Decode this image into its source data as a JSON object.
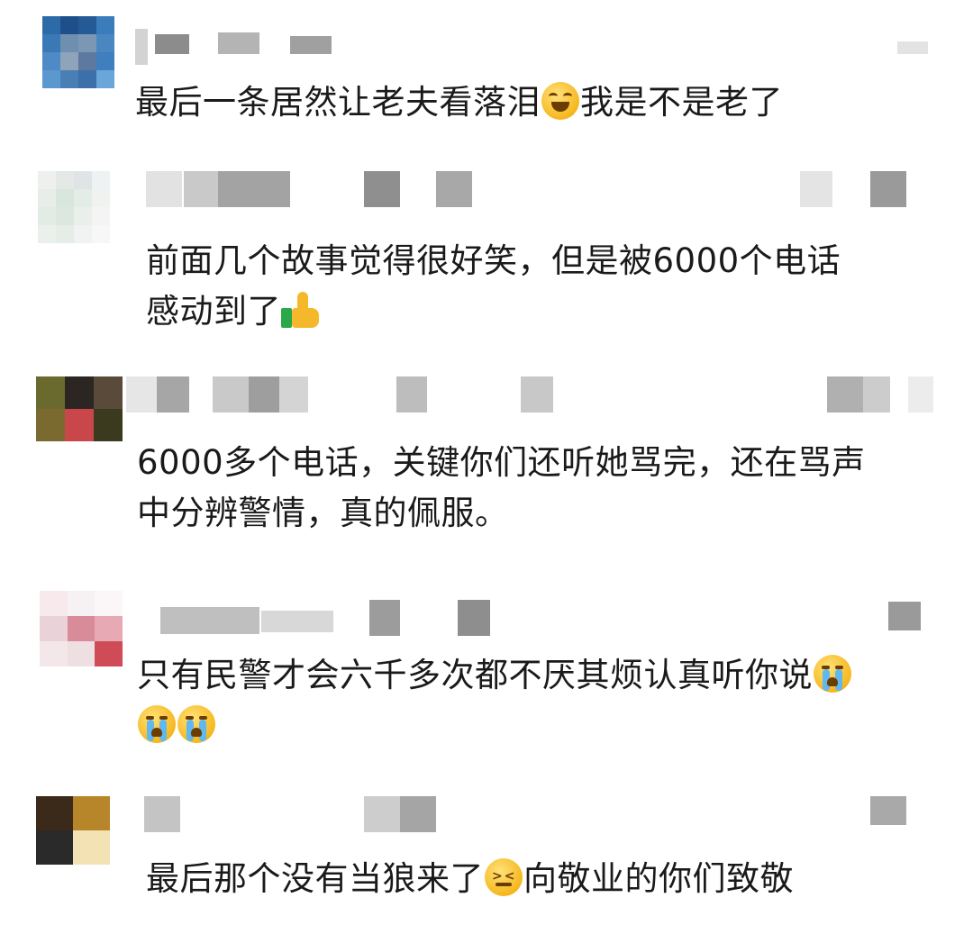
{
  "comments": [
    {
      "text": "最后一条居然让老夫看落泪",
      "text_after": "我是不是老了",
      "emoji": "laughing-crying-emoji"
    },
    {
      "text": "前面几个故事觉得很好笑，但是被6000个电话",
      "text_line2": "感动到了",
      "emoji": "thumbs-up-emoji"
    },
    {
      "text": "6000多个电话，关键你们还听她骂完，还在骂声",
      "text_line2": "中分辨警情，真的佩服。"
    },
    {
      "text": "只有民警才会六千多次都不厌其烦认真听你说",
      "emoji": "loudly-crying-emoji"
    },
    {
      "text": "最后那个没有当狼来了",
      "text_after": "向敬业的你们致敬",
      "emoji": "persevering-face-emoji"
    }
  ],
  "colors": {
    "text": "#1a1a1a",
    "background": "#ffffff",
    "blur_gray": "#b8b8b8",
    "blur_dark": "#8f8f8f"
  }
}
